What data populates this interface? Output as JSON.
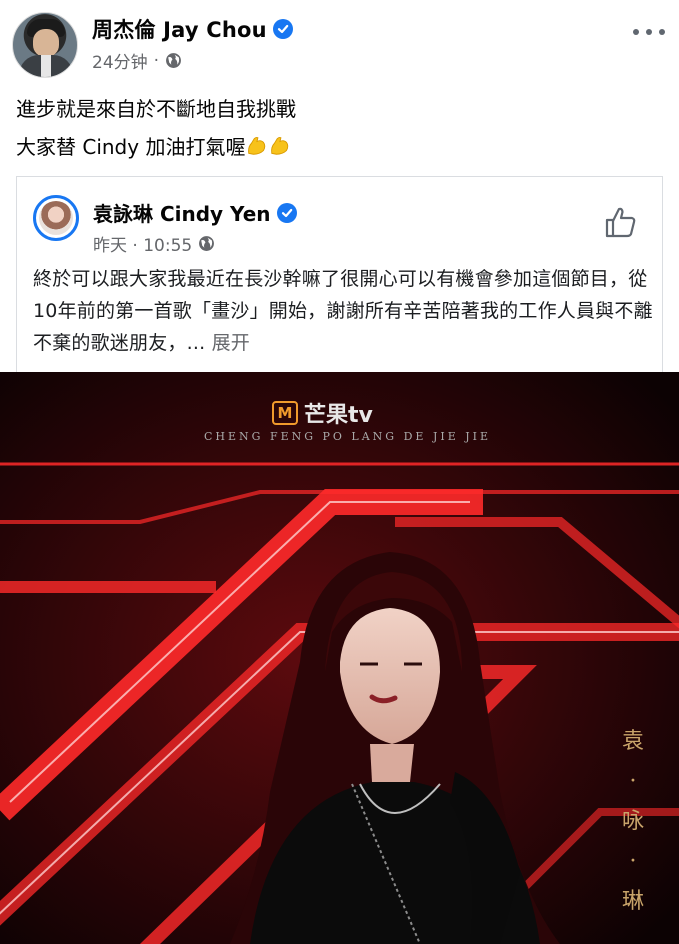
{
  "post": {
    "author_name": "周杰倫 Jay Chou",
    "time": "24分钟",
    "meta_dot": "·",
    "text_line_1": "進步就是來自於不斷地自我挑戰",
    "text_line_2": "大家替 Cindy 加油打氣喔"
  },
  "shared_post": {
    "author_name": "袁詠琳 Cindy Yen",
    "time": "昨天 · 10:55",
    "meta_dot": "·",
    "text": "終於可以跟大家我最近在長沙幹嘛了很開心可以有機會參加這個節目，從10年前的第一首歌「畫沙」開始，謝謝所有辛苦陪著我的工作人員與不離不棄的歌迷朋友，...",
    "expand_label": "展开"
  },
  "promo": {
    "logo_text": "芒果tv",
    "subtitle": "CHENG FENG PO LANG DE JIE JIE",
    "vertical_name": "袁·咏·琳"
  },
  "colors": {
    "verified_blue": "#1877f2",
    "meta_gray": "#65676b",
    "promo_red": "#e0141e"
  },
  "icons": [
    "verified-badge-icon",
    "globe-icon",
    "more-options-icon",
    "flexed-biceps-icon",
    "like-thumb-icon",
    "mango-tv-logo-icon"
  ]
}
